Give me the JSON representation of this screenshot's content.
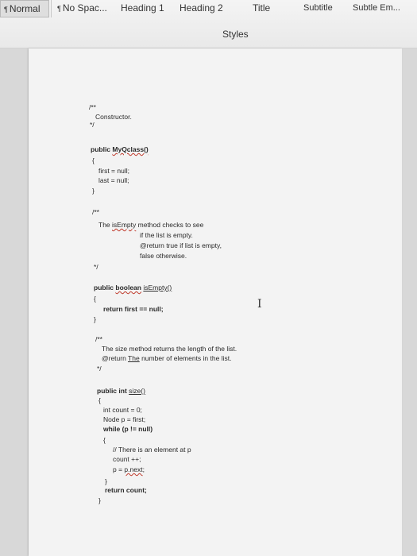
{
  "ribbon": {
    "styles": [
      {
        "label": "Normal",
        "mark": "¶",
        "selected": true
      },
      {
        "label": "No Spac...",
        "mark": "¶",
        "selected": false
      },
      {
        "label": "Heading 1",
        "mark": "",
        "selected": false
      },
      {
        "label": "Heading 2",
        "mark": "",
        "selected": false
      },
      {
        "label": "Title",
        "mark": "",
        "selected": false
      },
      {
        "label": "Subtitle",
        "mark": "",
        "selected": false
      },
      {
        "label": "Subtle Em...",
        "mark": "",
        "selected": false
      }
    ],
    "styles_pane_label": "Styles"
  },
  "document": {
    "comment_open_1": "/**",
    "constructor_comment": "Constructor.",
    "comment_close_1": "*/",
    "ctor_sig": "public MyQclass()",
    "brace_open_1": "{",
    "first_null": "first = null;",
    "last_null": "last = null;",
    "brace_close_1": "}",
    "comment_open_2": "/**",
    "isempty_line1": "The isEmpty method checks to see",
    "isempty_line2": "if the list is empty.",
    "isempty_line3": "@return true if list is empty,",
    "isempty_line4": "false otherwise.",
    "comment_close_2": "*/",
    "isempty_sig": "public boolean isEmpty()",
    "brace_open_2": "{",
    "return_first": "return first == null;",
    "brace_close_2": "}",
    "comment_open_3": "/**",
    "size_line1": "The size method returns the length of the list.",
    "size_line2": "@return The number of elements in the list.",
    "comment_close_3": "*/",
    "size_sig": "public int size()",
    "brace_open_3": "{",
    "count_init": "int count = 0;",
    "node_p": "Node p = first;",
    "while_loop": "while (p != null)",
    "brace_open_4": "{",
    "loop_comment": "// There is an element at p",
    "count_inc": "count ++;",
    "p_next": "p = p.next;",
    "brace_close_4": "}",
    "return_count": "return count;",
    "brace_close_3": "}"
  },
  "icons": {
    "text_cursor": "i-beam-cursor-icon"
  }
}
